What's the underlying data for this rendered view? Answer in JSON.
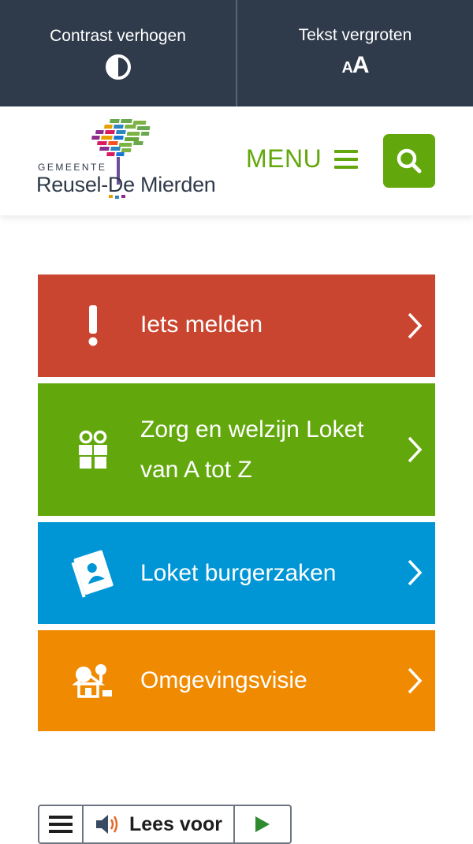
{
  "accessibility": {
    "contrast_label": "Contrast verhogen",
    "textsize_label": "Tekst vergroten",
    "textsize_icon_small": "A",
    "textsize_icon_large": "A"
  },
  "header": {
    "logo_small": "GEMEENTE",
    "logo_name": "Reusel-De Mierden",
    "menu_label": "MENU",
    "search_icon": "search-icon",
    "brand_color": "#62a80c"
  },
  "tiles": [
    {
      "label": "Iets melden",
      "icon": "exclamation-icon",
      "color": "#c9452f"
    },
    {
      "label": "Zorg en welzijn Loket van A tot Z",
      "icon": "people-icon",
      "color": "#62a80c"
    },
    {
      "label": "Loket burgerzaken",
      "icon": "passport-icon",
      "color": "#0096d6"
    },
    {
      "label": "Omgevingsvisie",
      "icon": "house-tree-icon",
      "color": "#f08a00"
    }
  ],
  "readspeaker": {
    "label": "Lees voor",
    "menu_icon": "hamburger-icon",
    "speaker_icon": "speaker-icon",
    "play_icon": "play-icon"
  }
}
